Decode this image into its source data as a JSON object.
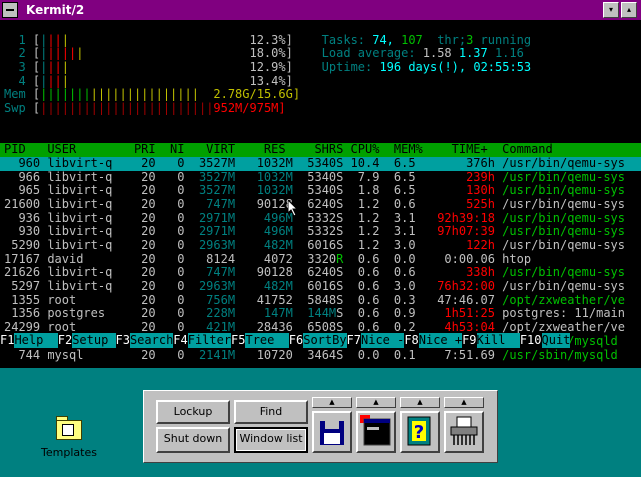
{
  "window": {
    "title": "Kermit/2",
    "sys_icon": "window-menu-icon",
    "btn_min": "▾",
    "btn_max": "▴"
  },
  "htop": {
    "cpus": [
      {
        "num": "1",
        "bars": "||||",
        "pct": "12.3%]"
      },
      {
        "num": "2",
        "bars": "||||||",
        "pct": "18.0%]"
      },
      {
        "num": "3",
        "bars": "||||",
        "pct": "12.9%]"
      },
      {
        "num": "4",
        "bars": "||||",
        "pct": "13.4%]"
      }
    ],
    "cpu_open": "[",
    "mem": {
      "label": "Mem",
      "bars": "||||||||||||||||||||||",
      "val": "2.78G/15.6G]"
    },
    "swp": {
      "label": "Swp",
      "bars": "||||||||||||||||||||||||",
      "val": "952M/975M]"
    },
    "tasks_label": "Tasks:",
    "tasks": "74",
    "thr": "107",
    "thr_label": "thr;",
    "running": "3",
    "running_label": "running",
    "load_label": "Load average:",
    "load1": "1.58",
    "load5": "1.37",
    "load15": "1.16",
    "uptime_label": "Uptime:",
    "uptime": "196 days(!), 02:55:53",
    "columns": [
      "PID",
      "USER",
      "PRI",
      "NI",
      "VIRT",
      "RES",
      "SHR",
      "S",
      "CPU%",
      "MEM%",
      "TIME+",
      "Command"
    ],
    "rows": [
      {
        "pid": "960",
        "user": "libvirt-q",
        "pri": "20",
        "ni": "0",
        "virt": "3527M",
        "res": "1032M",
        "shr": "5340",
        "s": "S",
        "cpu": "10.4",
        "mem": "6.5",
        "time": "376h",
        "cmd": "/usr/bin/qemu-sys"
      },
      {
        "pid": "966",
        "user": "libvirt-q",
        "pri": "20",
        "ni": "0",
        "virt": "3527M",
        "res": "1032M",
        "shr": "5340",
        "s": "S",
        "cpu": "7.9",
        "mem": "6.5",
        "time": "239h",
        "cmd": "/usr/bin/qemu-sys"
      },
      {
        "pid": "965",
        "user": "libvirt-q",
        "pri": "20",
        "ni": "0",
        "virt": "3527M",
        "res": "1032M",
        "shr": "5340",
        "s": "S",
        "cpu": "1.8",
        "mem": "6.5",
        "time": "130h",
        "cmd": "/usr/bin/qemu-sys"
      },
      {
        "pid": "21600",
        "user": "libvirt-q",
        "pri": "20",
        "ni": "0",
        "virt": "747M",
        "res": "90128",
        "shr": "6240",
        "s": "S",
        "cpu": "1.2",
        "mem": "0.6",
        "time": "525h",
        "cmd": "/usr/bin/qemu-sys"
      },
      {
        "pid": "936",
        "user": "libvirt-q",
        "pri": "20",
        "ni": "0",
        "virt": "2971M",
        "res": "496M",
        "shr": "5332",
        "s": "S",
        "cpu": "1.2",
        "mem": "3.1",
        "time": "92h39:18",
        "cmd": "/usr/bin/qemu-sys"
      },
      {
        "pid": "930",
        "user": "libvirt-q",
        "pri": "20",
        "ni": "0",
        "virt": "2971M",
        "res": "496M",
        "shr": "5332",
        "s": "S",
        "cpu": "1.2",
        "mem": "3.1",
        "time": "97h07:39",
        "cmd": "/usr/bin/qemu-sys"
      },
      {
        "pid": "5290",
        "user": "libvirt-q",
        "pri": "20",
        "ni": "0",
        "virt": "2963M",
        "res": "482M",
        "shr": "6016",
        "s": "S",
        "cpu": "1.2",
        "mem": "3.0",
        "time": "122h",
        "cmd": "/usr/bin/qemu-sys"
      },
      {
        "pid": "17167",
        "user": "david",
        "pri": "20",
        "ni": "0",
        "virt": "8124",
        "res": "4072",
        "shr": "3320",
        "s": "R",
        "cpu": "0.6",
        "mem": "0.0",
        "time": "0:00.06",
        "cmd": "htop"
      },
      {
        "pid": "21626",
        "user": "libvirt-q",
        "pri": "20",
        "ni": "0",
        "virt": "747M",
        "res": "90128",
        "shr": "6240",
        "s": "S",
        "cpu": "0.6",
        "mem": "0.6",
        "time": "338h",
        "cmd": "/usr/bin/qemu-sys"
      },
      {
        "pid": "5297",
        "user": "libvirt-q",
        "pri": "20",
        "ni": "0",
        "virt": "2963M",
        "res": "482M",
        "shr": "6016",
        "s": "S",
        "cpu": "0.6",
        "mem": "3.0",
        "time": "76h32:00",
        "cmd": "/usr/bin/qemu-sys"
      },
      {
        "pid": "1355",
        "user": "root",
        "pri": "20",
        "ni": "0",
        "virt": "756M",
        "res": "41752",
        "shr": "5848",
        "s": "S",
        "cpu": "0.6",
        "mem": "0.3",
        "time": "47:46.07",
        "cmd": "/opt/zxweather/ve"
      },
      {
        "pid": "1356",
        "user": "postgres",
        "pri": "20",
        "ni": "0",
        "virt": "228M",
        "res": "147M",
        "shr": "144M",
        "s": "S",
        "cpu": "0.6",
        "mem": "0.9",
        "time": "1h51:25",
        "cmd": "postgres: 11/main"
      },
      {
        "pid": "24299",
        "user": "root",
        "pri": "20",
        "ni": "0",
        "virt": "421M",
        "res": "28436",
        "shr": "6508",
        "s": "S",
        "cpu": "0.6",
        "mem": "0.2",
        "time": "4h53:04",
        "cmd": "/opt/zxweather/ve"
      },
      {
        "pid": "741",
        "user": "mysql",
        "pri": "20",
        "ni": "0",
        "virt": "2141M",
        "res": "10720",
        "shr": "3464",
        "s": "S",
        "cpu": "0.0",
        "mem": "0.1",
        "time": "7:53.08",
        "cmd": "/usr/sbin/mysqld"
      },
      {
        "pid": "744",
        "user": "mysql",
        "pri": "20",
        "ni": "0",
        "virt": "2141M",
        "res": "10720",
        "shr": "3464",
        "s": "S",
        "cpu": "0.0",
        "mem": "0.1",
        "time": "7:51.69",
        "cmd": "/usr/sbin/mysqld"
      }
    ],
    "footer": [
      {
        "key": "F1",
        "label": "Help  "
      },
      {
        "key": "F2",
        "label": "Setup "
      },
      {
        "key": "F3",
        "label": "Search"
      },
      {
        "key": "F4",
        "label": "Filter"
      },
      {
        "key": "F5",
        "label": "Tree  "
      },
      {
        "key": "F6",
        "label": "SortBy"
      },
      {
        "key": "F7",
        "label": "Nice -"
      },
      {
        "key": "F8",
        "label": "Nice +"
      },
      {
        "key": "F9",
        "label": "Kill  "
      },
      {
        "key": "F10",
        "label": "Quit"
      }
    ]
  },
  "desktop": {
    "templates_label": "Templates"
  },
  "launchpad": {
    "lockup": "Lockup",
    "find": "Find",
    "shutdown": "Shut down",
    "windowlist": "Window list",
    "arrow": "▲",
    "icons": [
      "drive-a-icon",
      "os2-window-icon",
      "help-icon",
      "shredder-icon"
    ]
  }
}
